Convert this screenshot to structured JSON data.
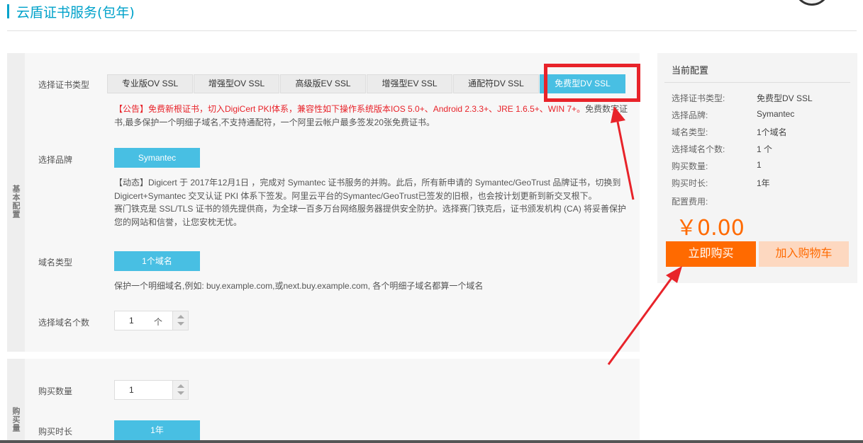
{
  "page": {
    "title": "云盾证书服务(包年)"
  },
  "basic_section": {
    "side_label": "基本配置"
  },
  "cert_type": {
    "label": "选择证书类型",
    "tabs": [
      "专业版OV SSL",
      "增强型OV SSL",
      "高级版EV SSL",
      "增强型EV SSL",
      "通配符DV SSL",
      "免费型DV SSL"
    ],
    "active_index": 5,
    "notice_red": "【公告】免费新根证书，切入DigiCert PKI体系，兼容性如下操作系统版本IOS 5.0+、Android 2.3.3+、JRE 1.6.5+、WIN 7+。",
    "notice_rest_1": "免费数字证",
    "notice_rest_2": "书,最多保护一个明细子域名,不支持通配符，一个阿里云帐户最多签发20张免费证书。"
  },
  "brand": {
    "label": "选择品牌",
    "value": "Symantec",
    "desc_1": "【动态】Digicert 于 2017年12月1日 ，完成对 Symantec 证书服务的并购。此后，所有新申请的 Symantec/GeoTrust 品牌证书，切换到",
    "desc_2": "Digicert+Symantec 交叉认证 PKI 体系下签发。阿里云平台的Symantec/GeoTrust已签发的旧根，也会按计划更新到新交叉根下。",
    "desc_3": "赛门铁克是 SSL/TLS 证书的领先提供商，为全球一百多万台网络服务器提供安全防护。选择赛门铁克后，证书颁发机构 (CA) 将妥善保护",
    "desc_4": "您的网站和信誉，让您安枕无忧。"
  },
  "domain_type": {
    "label": "域名类型",
    "value": "1个域名",
    "desc": "保护一个明细域名,例如: buy.example.com,或next.buy.example.com, 各个明细子域名都算一个域名"
  },
  "domain_count": {
    "label": "选择域名个数",
    "value": "1",
    "unit": "个"
  },
  "purchase_section": {
    "side_label": "购买量"
  },
  "quantity": {
    "label": "购买数量",
    "value": "1"
  },
  "duration": {
    "label": "购买时长",
    "value": "1年"
  },
  "config": {
    "title": "当前配置",
    "rows": [
      {
        "key": "选择证书类型:",
        "value": "免费型DV SSL"
      },
      {
        "key": "选择品牌:",
        "value": "Symantec"
      },
      {
        "key": "域名类型:",
        "value": "1个域名"
      },
      {
        "key": "选择域名个数:",
        "value": "1 个"
      },
      {
        "key": "购买数量:",
        "value": "1"
      },
      {
        "key": "购买时长:",
        "value": "1年"
      },
      {
        "key": "配置费用:",
        "value": ""
      }
    ],
    "price": "￥0.00",
    "buy_label": "立即购买",
    "cart_label": "加入购物车"
  },
  "colors": {
    "accent": "#48bfe3",
    "title": "#00a2ca",
    "price": "#ff6a00",
    "annotation": "#e8232a"
  }
}
